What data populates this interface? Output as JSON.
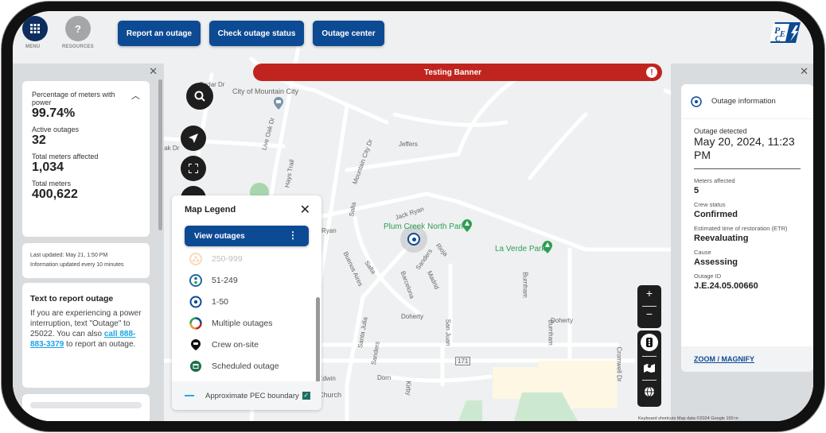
{
  "header": {
    "menu_label": "MENU",
    "resources_label": "RESOURCES",
    "buttons": [
      "Report an outage",
      "Check outage status",
      "Outage center"
    ],
    "logo_alt": "PEC"
  },
  "banner": {
    "text": "Testing Banner",
    "icon": "!"
  },
  "stats": {
    "items": [
      {
        "label": "Percentage of meters with power",
        "value": "99.74%"
      },
      {
        "label": "Active outages",
        "value": "32"
      },
      {
        "label": "Total meters affected",
        "value": "1,034"
      },
      {
        "label": "Total meters",
        "value": "400,622"
      }
    ],
    "last_updated": "Last updated:  May 21, 1:50 PM",
    "update_frequency": "Information updated every 10 minutes"
  },
  "text_report": {
    "title": "Text to report outage",
    "body_before": "If you are experiencing a power interruption, text \"Outage\" to 25022. You can also ",
    "link": "call 888-883-3379",
    "body_after": " to report an outage."
  },
  "legend": {
    "title": "Map Legend",
    "view_button": "View outages",
    "items": [
      {
        "label": "250-999",
        "icon": "cluster-orange-icon"
      },
      {
        "label": "51-249",
        "icon": "cluster-blue-icon"
      },
      {
        "label": "1-50",
        "icon": "single-outage-icon"
      },
      {
        "label": "Multiple outages",
        "icon": "multiple-outages-icon"
      },
      {
        "label": "Crew on-site",
        "icon": "crew-pin-icon"
      },
      {
        "label": "Scheduled outage",
        "icon": "scheduled-outage-icon"
      }
    ],
    "boundary_label": "Approximate PEC boundary",
    "boundary_checked": true,
    "colors": {
      "boundary_line": "#29a8e0",
      "checkbox": "#1c6f5e"
    }
  },
  "outage_info": {
    "header": "Outage information",
    "detected_label": "Outage detected",
    "detected_value": "May 20, 2024, 11:23 PM",
    "fields": [
      {
        "label": "Meters affected",
        "value": "5"
      },
      {
        "label": "Crew status",
        "value": "Confirmed"
      },
      {
        "label": "Estimated time of restoration (ETR)",
        "value": "Reevaluating"
      },
      {
        "label": "Cause",
        "value": "Assessing"
      },
      {
        "label": "Outage ID",
        "value": "J.E.24.05.00660"
      }
    ],
    "zoom_link": "ZOOM / MAGNIFY"
  },
  "map": {
    "labels": {
      "cedar": "Cedar Dr",
      "city": "City of Mountain City",
      "liveoak": "Live Oak Dr",
      "oak": "Oak Dr",
      "hays": "Hays Trail",
      "mountaincity": "Mountain City Dr",
      "jeffers": "Jeffers",
      "jackryan": "Jack Ryan",
      "ryan": "Ryan",
      "salta": "Salta",
      "plumcreek": "Plum Creek North Park",
      "laverde": "La Verde Park",
      "sanders": "Sanders",
      "rioja": "Rioja",
      "madrid": "Madrid",
      "barcelona": "Barcelona",
      "buenosaires": "Buenos Aires",
      "burnham": "Burnham",
      "doherty": "Doherty",
      "sanjuan": "San Juan",
      "santajulia": "Santa Julia",
      "hwy": "171",
      "dorn": "Dorn",
      "edwin": "Edwin",
      "kirby": "Kirby",
      "church": "Church",
      "cromwell": "Cromwell Dr"
    },
    "attribution": "Keyboard shortcuts    Map data ©2024 Google    100 m",
    "google": "ogle",
    "zoom_in": "+",
    "zoom_out": "−"
  },
  "colors": {
    "primary": "#0d4a94",
    "banner": "#c0241f",
    "link": "#1aa3e8",
    "park": "#2f9e55"
  }
}
